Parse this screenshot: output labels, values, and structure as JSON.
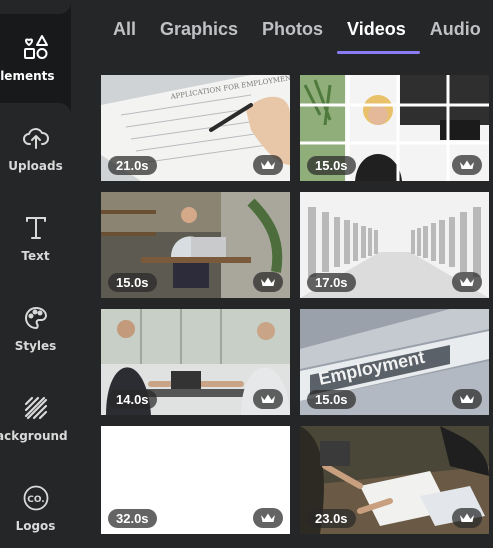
{
  "sidebar": {
    "items": [
      {
        "label": "Elements",
        "icon": "elements-icon",
        "active": true
      },
      {
        "label": "Uploads",
        "icon": "upload-cloud-icon"
      },
      {
        "label": "Text",
        "icon": "text-icon"
      },
      {
        "label": "Styles",
        "icon": "palette-icon"
      },
      {
        "label": "ackground",
        "icon": "background-icon"
      },
      {
        "label": "Logos",
        "icon": "logo-icon"
      }
    ]
  },
  "tabs": [
    {
      "label": "All"
    },
    {
      "label": "Graphics"
    },
    {
      "label": "Photos"
    },
    {
      "label": "Videos",
      "active": true
    },
    {
      "label": "Audio"
    }
  ],
  "videos": [
    {
      "duration": "21.0s",
      "scene": "application-form"
    },
    {
      "duration": "15.0s",
      "scene": "puzzle-woman"
    },
    {
      "duration": "15.0s",
      "scene": "office-man-laptop"
    },
    {
      "duration": "17.0s",
      "scene": "white-figures"
    },
    {
      "duration": "14.0s",
      "scene": "handshake-meeting"
    },
    {
      "duration": "15.0s",
      "scene": "employment-folder"
    },
    {
      "duration": "32.0s",
      "scene": "blank-white"
    },
    {
      "duration": "23.0s",
      "scene": "team-documents"
    }
  ],
  "colors": {
    "accent": "#8b7cf6",
    "panel": "#252627",
    "rail": "#18191b"
  },
  "premium_icon": "crown-icon"
}
